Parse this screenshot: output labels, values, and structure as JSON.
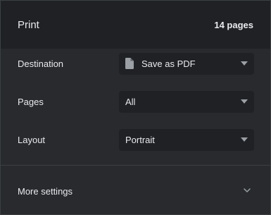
{
  "header": {
    "title": "Print",
    "page_count": "14 pages"
  },
  "settings": {
    "destination": {
      "label": "Destination",
      "value": "Save as PDF",
      "icon": "document-icon"
    },
    "pages": {
      "label": "Pages",
      "value": "All"
    },
    "layout": {
      "label": "Layout",
      "value": "Portrait"
    }
  },
  "more_settings": {
    "label": "More settings",
    "icon": "chevron-down-icon"
  },
  "colors": {
    "background": "#202124",
    "section_background": "#292a2d",
    "select_background": "#202124",
    "text": "#e8eaed",
    "icon": "#9aa0a6",
    "divider": "#3c4043"
  }
}
